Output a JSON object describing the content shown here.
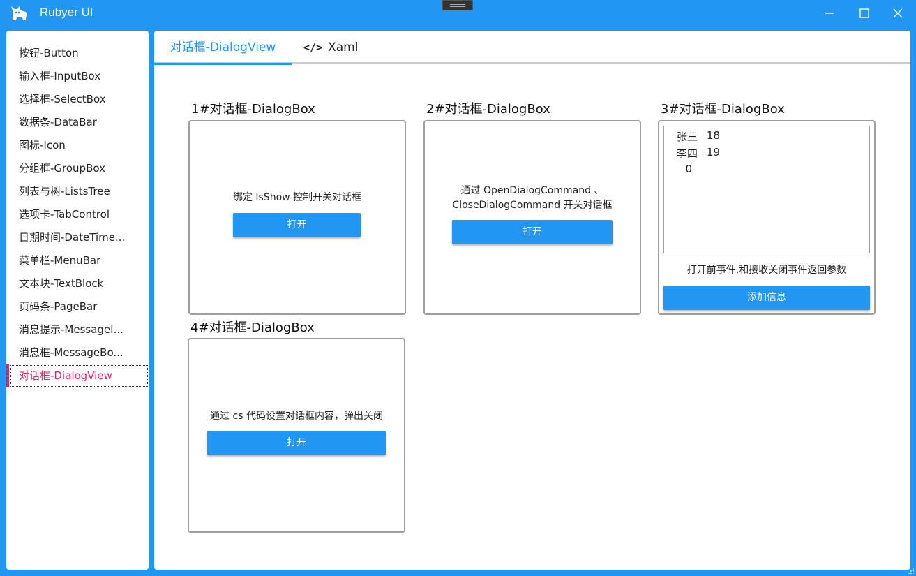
{
  "window": {
    "title": "Rubyer UI",
    "brand_color": "#2196F3",
    "accent_color": "#E91E63",
    "icons": {
      "logo": "cat-logo-icon",
      "minimize": "minimize-icon",
      "maximize": "maximize-icon",
      "close": "close-icon"
    }
  },
  "sidebar": {
    "items": [
      {
        "label": "按钮-Button"
      },
      {
        "label": "输入框-InputBox"
      },
      {
        "label": "选择框-SelectBox"
      },
      {
        "label": "数据条-DataBar"
      },
      {
        "label": "图标-Icon"
      },
      {
        "label": "分组框-GroupBox"
      },
      {
        "label": "列表与树-ListsTree"
      },
      {
        "label": "选项卡-TabControl"
      },
      {
        "label": "日期时间-DateTime..."
      },
      {
        "label": "菜单栏-MenuBar"
      },
      {
        "label": "文本块-TextBlock"
      },
      {
        "label": "页码条-PageBar"
      },
      {
        "label": "消息提示-MessageI..."
      },
      {
        "label": "消息框-MessageBo..."
      },
      {
        "label": "对话框-DialogView",
        "active": true
      }
    ]
  },
  "tabs": {
    "dialog": "对话框-DialogView",
    "xaml": "Xaml",
    "xaml_icon": "code-icon"
  },
  "cards": {
    "c1": {
      "title": "1#对话框-DialogBox",
      "text": "绑定 IsShow 控制开关对话框",
      "button": "打开"
    },
    "c2": {
      "title": "2#对话框-DialogBox",
      "text_line1": "通过 OpenDialogCommand 、",
      "text_line2": "CloseDialogCommand 开关对话框",
      "button": "打开"
    },
    "c3": {
      "title": "3#对话框-DialogBox",
      "rows": [
        {
          "name": "张三",
          "age": "18"
        },
        {
          "name": "李四",
          "age": "19"
        },
        {
          "name": "",
          "age": ""
        }
      ],
      "extra_value": "0",
      "text": "打开前事件,和接收关闭事件返回参数",
      "button": "添加信息"
    },
    "c4": {
      "title": "4#对话框-DialogBox",
      "text": "通过 cs 代码设置对话框内容，弹出关闭",
      "button": "打开"
    }
  }
}
